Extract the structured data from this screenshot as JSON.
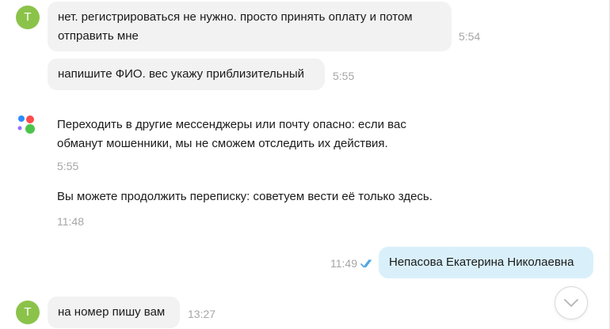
{
  "messages": {
    "m1": {
      "avatar_letter": "Т",
      "line1": "нет. регистрироваться не нужно. просто принять оплату и потом",
      "line2": "отправить мне",
      "time": "5:54"
    },
    "m2": {
      "text": "напишите ФИО. вес укажу приблизительный",
      "time": "5:55"
    },
    "system1": {
      "line1": "Переходить в другие мессенджеры или почту опасно: если вас",
      "line2": "обманут мошенники, мы не сможем отследить их действия.",
      "time": "5:55"
    },
    "system2": {
      "text": "Вы можете продолжить переписку: советуем вести её только здесь.",
      "time": "11:48"
    },
    "out1": {
      "text": "Непасова Екатерина Николаевна",
      "time": "11:49",
      "status_icon": "double-check-icon"
    },
    "m3": {
      "avatar_letter": "Т",
      "text": "на номер пишу вам",
      "time": "13:27"
    }
  },
  "colors": {
    "avatar": "#8bc34a",
    "incoming_bubble": "#f2f2f2",
    "outgoing_bubble": "#d9f0fb",
    "timestamp": "#a6a6a6",
    "read_check": "#4aa3df",
    "logo_blue": "#2d8cff",
    "logo_red": "#ff4b4b",
    "logo_purple": "#9b6bff",
    "logo_green": "#4cc44c"
  },
  "icons": {
    "service_logo": "service-logo-icon",
    "scroll_down": "chevron-down-icon"
  }
}
